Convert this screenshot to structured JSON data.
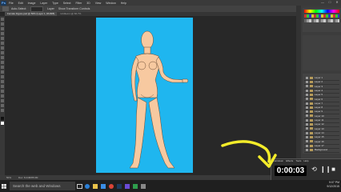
{
  "menubar": {
    "logo": "Ps",
    "items": [
      "File",
      "Edit",
      "Image",
      "Layer",
      "Type",
      "Select",
      "Filter",
      "3D",
      "View",
      "Window",
      "Help"
    ],
    "window_controls": [
      "—",
      "□",
      "✕"
    ]
  },
  "optionsbar": {
    "labels": [
      "Auto-Select:",
      "Layer",
      "Show Transform Controls"
    ]
  },
  "doc_tabs": [
    {
      "label": "Female Figure.psd @ 50% (Layer 1, RGB/8)",
      "active": true
    },
    {
      "label": "Untitled-1 @ 66.7%",
      "active": false
    }
  ],
  "statusbar": {
    "zoom": "50%",
    "doc": "Doc: 8.24M/85.9M"
  },
  "layers_panel": {
    "rows": [
      "Layer 1",
      "Layer 2",
      "Layer 3",
      "Layer 4",
      "Layer 5",
      "Layer 6",
      "Layer 7",
      "Layer 8",
      "Layer 9",
      "Layer 10",
      "Layer 11",
      "Layer 12",
      "Layer 13",
      "Layer 14",
      "Layer 15",
      "Layer 16",
      "Layer 17",
      "Background"
    ]
  },
  "timer": {
    "tabs": [
      "Countdown",
      "Effects",
      "Tools",
      "Help"
    ],
    "display": "0:00:03",
    "buttons": [
      "⟲",
      "❙❙",
      "■"
    ]
  },
  "taskbar": {
    "search_placeholder": "Search the web and Windows",
    "time": "9:07 PM",
    "date": "9/12/2015"
  },
  "colors": {
    "artboard": "#1fb6ef",
    "skin": "#f7c9a0",
    "arrow": "#f3ec2a",
    "ui_dark": "#282828"
  }
}
